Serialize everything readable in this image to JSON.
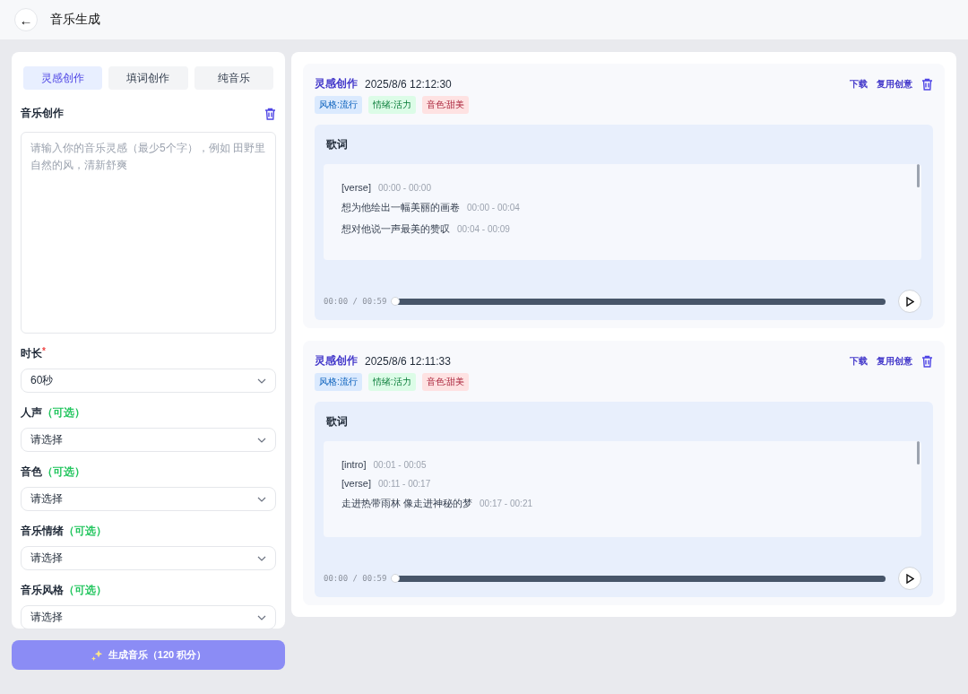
{
  "header": {
    "back_icon": "←",
    "title": "音乐生成"
  },
  "create_panel": {
    "tabs": [
      {
        "label": "灵感创作",
        "selected": true
      },
      {
        "label": "填词创作",
        "selected": false
      },
      {
        "label": "纯音乐",
        "selected": false
      }
    ],
    "section_title": "音乐创作",
    "prompt": {
      "placeholder": "请输入你的音乐灵感（最少5个字），例如 田野里自然的风，清新舒爽"
    },
    "fields": [
      {
        "label": "时长",
        "mark": "*",
        "value": "60秒"
      },
      {
        "label": "人声",
        "hint": "（可选）",
        "placeholder": "请选择"
      },
      {
        "label": "音色",
        "hint": "（可选）",
        "placeholder": "请选择"
      },
      {
        "label": "音乐情绪",
        "hint": "（可选）",
        "placeholder": "请选择"
      },
      {
        "label": "音乐风格",
        "hint": "（可选）",
        "placeholder": "请选择"
      }
    ],
    "generate_button": "生成音乐（120 积分）"
  },
  "results": [
    {
      "mode": "灵感创作",
      "time": "2025/8/6 12:12:30",
      "actions": [
        "下载",
        "复用创意"
      ],
      "tags": [
        {
          "text": "风格:流行",
          "color": "#dbeafe"
        },
        {
          "text": "情绪:活力",
          "color": "#dcfce7"
        },
        {
          "text": "音色:甜美",
          "color": "#fee2e2"
        }
      ],
      "lyrics_title": "歌词",
      "lyrics": [
        {
          "text": "[verse]",
          "time": "00:00 - 00:00"
        },
        {
          "text": "想为他绘出一幅美丽的画卷",
          "time": "00:00 - 00:04"
        },
        {
          "text": "想对他说一声最美的赞叹",
          "time": "00:04 - 00:09"
        }
      ],
      "player": {
        "time": "00:00 / 00:59",
        "level": 0
      }
    },
    {
      "mode": "灵感创作",
      "time": "2025/8/6 12:11:33",
      "actions": [
        "下载",
        "复用创意"
      ],
      "tags": [
        {
          "text": "风格:流行",
          "color": "#dbeafe"
        },
        {
          "text": "情绪:活力",
          "color": "#dcfce7"
        },
        {
          "text": "音色:甜美",
          "color": "#fee2e2"
        }
      ],
      "lyrics_title": "歌词",
      "lyrics": [
        {
          "text": "[intro]",
          "time": "00:01 - 00:05"
        },
        {
          "text": "[verse]",
          "time": "00:11 - 00:17"
        },
        {
          "text": "走进热带雨林 像走进神秘的梦",
          "time": "00:17 - 00:21"
        }
      ],
      "player": {
        "time": "00:00 / 00:59",
        "level": 0
      }
    }
  ]
}
